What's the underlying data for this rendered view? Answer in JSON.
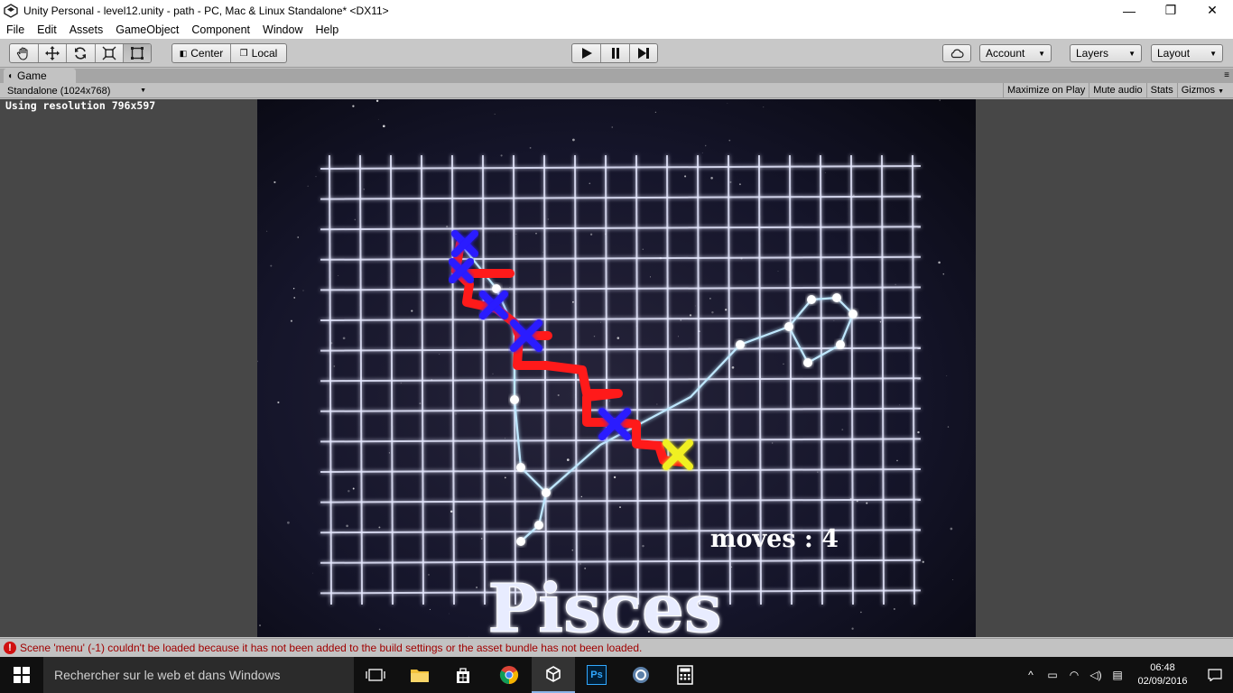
{
  "window": {
    "title": "Unity Personal - level12.unity - path - PC, Mac & Linux Standalone* <DX11>",
    "minimize": "—",
    "maximize": "❐",
    "close": "✕"
  },
  "menu": [
    "File",
    "Edit",
    "Assets",
    "GameObject",
    "Component",
    "Window",
    "Help"
  ],
  "toolbar": {
    "tools": [
      "hand-tool-icon",
      "move-tool-icon",
      "rotate-tool-icon",
      "scale-tool-icon",
      "rect-tool-icon"
    ],
    "pivot_label": "Center",
    "space_label": "Local",
    "play_icons": [
      "play-icon",
      "pause-icon",
      "step-icon"
    ],
    "cloud_icon": "cloud-icon",
    "account_label": "Account",
    "layers_label": "Layers",
    "layout_label": "Layout"
  },
  "game_tab": {
    "label": "Game",
    "resolution_option": "Standalone (1024x768)",
    "maximize_on_play": "Maximize on Play",
    "mute_audio": "Mute audio",
    "stats": "Stats",
    "gizmos": "Gizmos",
    "resolution_info": "Using resolution 796x597"
  },
  "game": {
    "moves_text": "moves : 4",
    "title_text": "Pisces",
    "colors": {
      "grid": "#e6e9ff",
      "constellation": "#bfe8ff",
      "path": "#ff1a1a",
      "visited": "#2b1aff",
      "target": "#f0f020"
    }
  },
  "status": {
    "error_icon": "!",
    "message": "Scene 'menu' (-1) couldn't be loaded because it has not been added to the build settings or the asset bundle has not been loaded."
  },
  "taskbar": {
    "search_placeholder": "Rechercher sur le web et dans Windows",
    "apps": [
      "task-view-icon",
      "file-explorer-icon",
      "store-icon",
      "chrome-icon",
      "unity-icon",
      "photoshop-icon",
      "app-icon",
      "calculator-icon"
    ],
    "photoshop_label": "Ps",
    "tray_arrow": "^",
    "time": "06:48",
    "date": "02/09/2016"
  }
}
